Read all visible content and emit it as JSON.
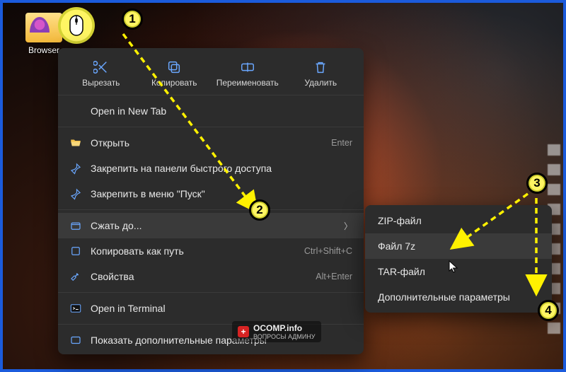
{
  "desktop": {
    "folder_label": "Browser"
  },
  "context_menu": {
    "top_actions": {
      "cut": "Вырезать",
      "copy": "Копировать",
      "rename": "Переименовать",
      "delete": "Удалить"
    },
    "open_new_tab": "Open in New Tab",
    "open": "Открыть",
    "open_shortcut": "Enter",
    "pin_quick": "Закрепить на панели быстрого доступа",
    "pin_start": "Закрепить в меню \"Пуск\"",
    "compress": "Сжать до...",
    "copy_path": "Копировать как путь",
    "copy_path_shortcut": "Ctrl+Shift+C",
    "properties": "Свойства",
    "properties_shortcut": "Alt+Enter",
    "open_terminal": "Open in Terminal",
    "show_more": "Показать дополнительные параметры"
  },
  "submenu": {
    "zip": "ZIP-файл",
    "sevenz": "Файл 7z",
    "tar": "TAR-файл",
    "more": "Дополнительные параметры"
  },
  "markers": {
    "m1": "1",
    "m2": "2",
    "m3": "3",
    "m4": "4"
  },
  "watermark": {
    "brand": "OCOMP.info",
    "sub": "ВОПРОСЫ АДМИНУ"
  }
}
